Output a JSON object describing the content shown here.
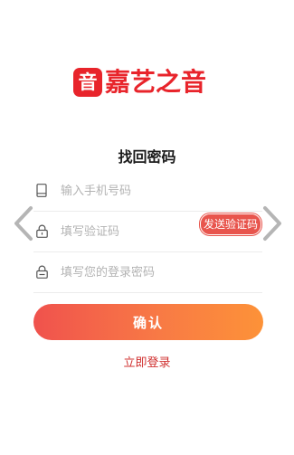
{
  "logo": {
    "mark": "音",
    "text": "嘉艺之音"
  },
  "title": "找回密码",
  "form": {
    "phone_placeholder": "输入手机号码",
    "code_placeholder": "填写验证码",
    "password_placeholder": "填写您的登录密码",
    "send_code_label": "发送验证码"
  },
  "confirm_label": "确认",
  "login_link": "立即登录",
  "icons": {
    "phone": "phone-icon",
    "code": "lock-icon",
    "password": "lock-icon",
    "prev": "chevron-left-icon",
    "next": "chevron-right-icon"
  },
  "colors": {
    "brand": "#e8242b",
    "send_code": "#e8554d",
    "button_start": "#f0524d",
    "button_end": "#fd9238",
    "link": "#d0302f"
  }
}
